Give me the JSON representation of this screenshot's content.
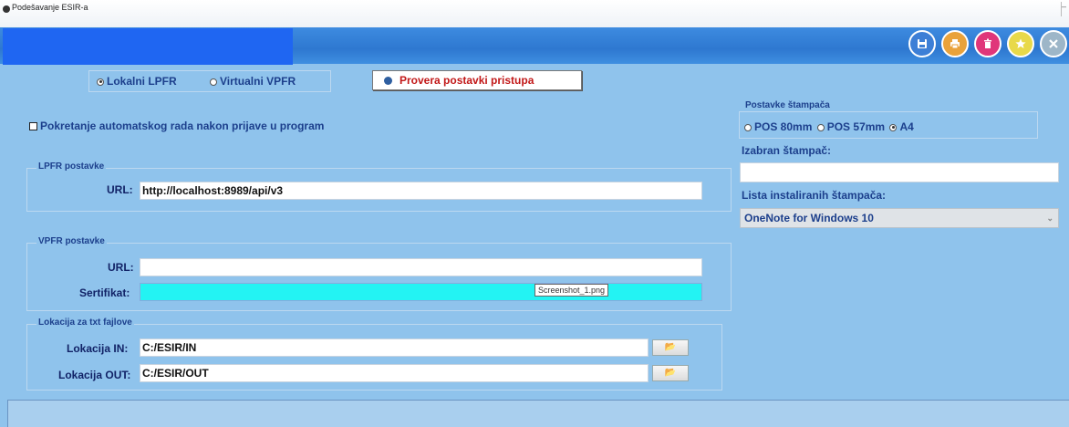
{
  "window": {
    "title": "Podešavanje ESIR-a"
  },
  "header": {
    "buttons": [
      {
        "icon": "save-icon",
        "color": "#3d7fd6"
      },
      {
        "icon": "print-icon",
        "color": "#e9a23b"
      },
      {
        "icon": "delete-icon",
        "color": "#e0367a"
      },
      {
        "icon": "star-icon",
        "color": "#e8d94a"
      },
      {
        "icon": "close-icon",
        "color": "#9db6c8"
      }
    ]
  },
  "mode": {
    "options": [
      "Lokalni LPFR",
      "Virtualni VPFR"
    ],
    "selected": "Lokalni LPFR",
    "check_button": "Provera postavki pristupa"
  },
  "auto_start": {
    "label": "Pokretanje automatskog rada nakon prijave u program",
    "checked": false
  },
  "lpfr": {
    "group_title": "LPFR postavke",
    "url_label": "URL:",
    "url_value": "http://localhost:8989/api/v3"
  },
  "vpfr": {
    "group_title": "VPFR postavke",
    "url_label": "URL:",
    "url_value": "",
    "cert_label": "Sertifikat:",
    "cert_value": ""
  },
  "tooltip": "Screenshot_1.png",
  "txt_location": {
    "group_title": "Lokacija za txt fajlove",
    "in_label": "Lokacija IN:",
    "in_value": "C:/ESIR/IN",
    "out_label": "Lokacija OUT:",
    "out_value": "C:/ESIR/OUT"
  },
  "printer": {
    "group_title": "Postavke štampača",
    "options": [
      "POS 80mm",
      "POS 57mm",
      "A4"
    ],
    "selected": "A4",
    "selected_printer_label": "Izabran štampač:",
    "selected_printer_value": "",
    "installed_label": "Lista instaliranih štampača:",
    "installed_value": "OneNote for Windows 10"
  }
}
